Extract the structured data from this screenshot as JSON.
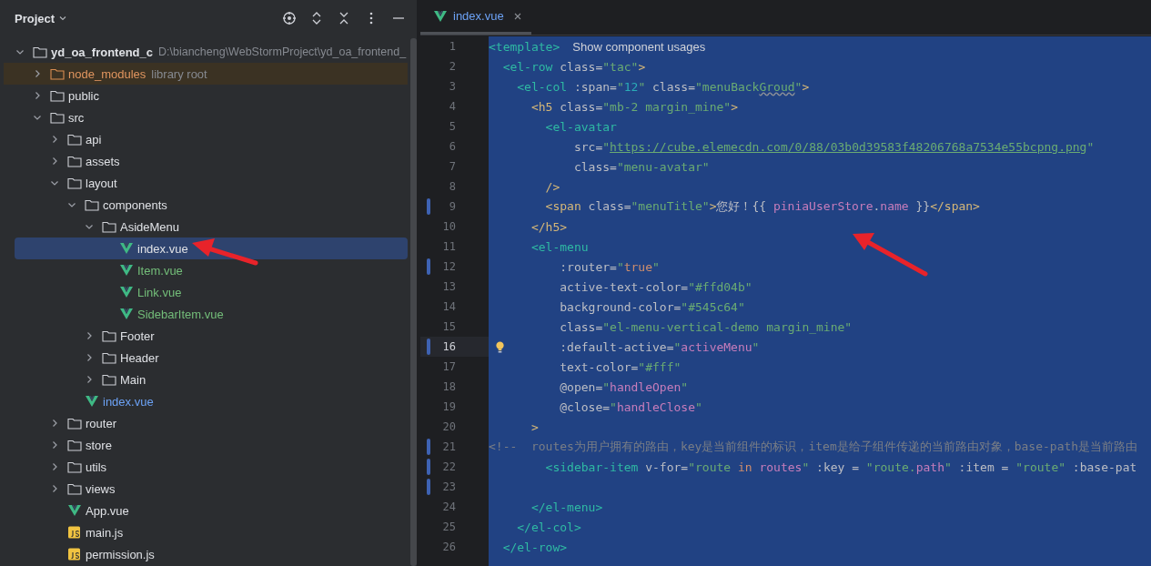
{
  "project_panel": {
    "title": "Project",
    "tree": [
      {
        "name": "yd_oa_frontend_c",
        "path": "D:\\biancheng\\WebStormProject\\yd_oa_frontend_",
        "kind": "folder",
        "expanded": true,
        "selected": false,
        "children": [
          {
            "name": "node_modules",
            "note": "library root",
            "kind": "library",
            "expanded": false,
            "selected": false
          },
          {
            "name": "public",
            "kind": "folder",
            "expanded": false,
            "selected": false
          },
          {
            "name": "src",
            "kind": "folder",
            "expanded": true,
            "selected": false,
            "children": [
              {
                "name": "api",
                "kind": "folder",
                "expanded": false,
                "selected": false
              },
              {
                "name": "assets",
                "kind": "folder",
                "expanded": false,
                "selected": false
              },
              {
                "name": "layout",
                "kind": "folder",
                "expanded": true,
                "selected": false,
                "children": [
                  {
                    "name": "components",
                    "kind": "folder",
                    "expanded": true,
                    "selected": false,
                    "children": [
                      {
                        "name": "AsideMenu",
                        "kind": "folder",
                        "expanded": true,
                        "selected": false,
                        "children": [
                          {
                            "name": "index.vue",
                            "kind": "vue",
                            "color": "#dfe1e5",
                            "selected": true
                          },
                          {
                            "name": "Item.vue",
                            "kind": "vue",
                            "color": "#73bd79",
                            "selected": false
                          },
                          {
                            "name": "Link.vue",
                            "kind": "vue",
                            "color": "#73bd79",
                            "selected": false
                          },
                          {
                            "name": "SidebarItem.vue",
                            "kind": "vue",
                            "color": "#73bd79",
                            "selected": false
                          }
                        ]
                      },
                      {
                        "name": "Footer",
                        "kind": "folder",
                        "expanded": false,
                        "selected": false
                      },
                      {
                        "name": "Header",
                        "kind": "folder",
                        "expanded": false,
                        "selected": false
                      },
                      {
                        "name": "Main",
                        "kind": "folder",
                        "expanded": false,
                        "selected": false
                      }
                    ]
                  },
                  {
                    "name": "index.vue",
                    "kind": "vue",
                    "color": "#6ca2f5",
                    "selected": false
                  }
                ]
              },
              {
                "name": "router",
                "kind": "folder",
                "expanded": false,
                "selected": false
              },
              {
                "name": "store",
                "kind": "folder",
                "expanded": false,
                "selected": false
              },
              {
                "name": "utils",
                "kind": "folder",
                "expanded": false,
                "selected": false
              },
              {
                "name": "views",
                "kind": "folder",
                "expanded": false,
                "selected": false
              },
              {
                "name": "App.vue",
                "kind": "vue",
                "color": "#dfe1e5",
                "selected": false
              },
              {
                "name": "main.js",
                "kind": "js",
                "color": "#dfe1e5",
                "selected": false
              },
              {
                "name": "permission.js",
                "kind": "js",
                "color": "#dfe1e5",
                "selected": false
              }
            ]
          }
        ]
      }
    ]
  },
  "editor": {
    "tabs": [
      {
        "label": "index.vue",
        "selected": true
      }
    ],
    "lines": [
      {
        "number": "1",
        "changed": false,
        "current": false,
        "tokens": [
          {
            "kind": "comp",
            "text": "<template>"
          }
        ],
        "hint": "Show component usages"
      },
      {
        "number": "2",
        "changed": false,
        "current": false,
        "tokens": [
          {
            "kind": "comp",
            "text": "  <el-row"
          },
          {
            "kind": "attr",
            "text": " class="
          },
          {
            "kind": "str",
            "text": "\"tac\""
          },
          {
            "kind": "br",
            "text": ">"
          }
        ]
      },
      {
        "number": "3",
        "changed": false,
        "current": false,
        "tokens": [
          {
            "kind": "comp",
            "text": "    <el-col"
          },
          {
            "kind": "attr",
            "text": " :span="
          },
          {
            "kind": "str",
            "text": "\""
          },
          {
            "kind": "num",
            "text": "12"
          },
          {
            "kind": "str",
            "text": "\""
          },
          {
            "kind": "attr",
            "text": " class="
          },
          {
            "kind": "str",
            "text": "\"menuBack"
          },
          {
            "kind": "typo",
            "text": "Groud"
          },
          {
            "kind": "str",
            "text": "\""
          },
          {
            "kind": "br",
            "text": ">"
          }
        ]
      },
      {
        "number": "4",
        "changed": false,
        "current": false,
        "tokens": [
          {
            "kind": "br",
            "text": "      <h5"
          },
          {
            "kind": "attr",
            "text": " class="
          },
          {
            "kind": "str",
            "text": "\"mb-2 margin_mine\""
          },
          {
            "kind": "br",
            "text": ">"
          }
        ]
      },
      {
        "number": "5",
        "changed": false,
        "current": false,
        "tokens": [
          {
            "kind": "comp",
            "text": "        <el-avatar"
          }
        ]
      },
      {
        "number": "6",
        "changed": false,
        "current": false,
        "tokens": [
          {
            "kind": "attr",
            "text": "            src="
          },
          {
            "kind": "str",
            "text": "\""
          },
          {
            "kind": "url",
            "text": "https://cube.elemecdn.com/0/88/03b0d39583f48206768a7534e55bcpng.png"
          },
          {
            "kind": "str",
            "text": "\""
          }
        ]
      },
      {
        "number": "7",
        "changed": false,
        "current": false,
        "tokens": [
          {
            "kind": "attr",
            "text": "            class="
          },
          {
            "kind": "str",
            "text": "\"menu-avatar\""
          }
        ]
      },
      {
        "number": "8",
        "changed": false,
        "current": false,
        "tokens": [
          {
            "kind": "br",
            "text": "        />"
          }
        ]
      },
      {
        "number": "9",
        "changed": true,
        "current": false,
        "tokens": [
          {
            "kind": "br",
            "text": "        <span"
          },
          {
            "kind": "attr",
            "text": " class="
          },
          {
            "kind": "str",
            "text": "\"menuTitle\""
          },
          {
            "kind": "br",
            "text": ">"
          },
          {
            "kind": "text",
            "text": "您好！{{ "
          },
          {
            "kind": "var",
            "text": "piniaUserStore"
          },
          {
            "kind": "text",
            "text": "."
          },
          {
            "kind": "var",
            "text": "name"
          },
          {
            "kind": "text",
            "text": " }}"
          },
          {
            "kind": "br",
            "text": "</span>"
          }
        ]
      },
      {
        "number": "10",
        "changed": false,
        "current": false,
        "tokens": [
          {
            "kind": "br",
            "text": "      </h5>"
          }
        ]
      },
      {
        "number": "11",
        "changed": false,
        "current": false,
        "tokens": [
          {
            "kind": "comp",
            "text": "      <el-menu"
          }
        ]
      },
      {
        "number": "12",
        "changed": true,
        "current": false,
        "tokens": [
          {
            "kind": "attr",
            "text": "          :router="
          },
          {
            "kind": "str",
            "text": "\""
          },
          {
            "kind": "kw",
            "text": "true"
          },
          {
            "kind": "str",
            "text": "\""
          }
        ]
      },
      {
        "number": "13",
        "changed": false,
        "current": false,
        "tokens": [
          {
            "kind": "attr",
            "text": "          active-text-color="
          },
          {
            "kind": "str",
            "text": "\"#ffd04b\""
          }
        ]
      },
      {
        "number": "14",
        "changed": false,
        "current": false,
        "tokens": [
          {
            "kind": "attr",
            "text": "          background-color="
          },
          {
            "kind": "str",
            "text": "\"#545c64\""
          }
        ]
      },
      {
        "number": "15",
        "changed": false,
        "current": false,
        "tokens": [
          {
            "kind": "attr",
            "text": "          class="
          },
          {
            "kind": "str",
            "text": "\"el-menu-vertical-demo margin_mine\""
          }
        ]
      },
      {
        "number": "16",
        "changed": true,
        "current": true,
        "tokens": [
          {
            "kind": "attr",
            "text": "          :default-active="
          },
          {
            "kind": "str",
            "text": "\""
          },
          {
            "kind": "var",
            "text": "activeMenu"
          },
          {
            "kind": "str",
            "text": "\""
          }
        ]
      },
      {
        "number": "17",
        "changed": false,
        "current": false,
        "tokens": [
          {
            "kind": "attr",
            "text": "          text-color="
          },
          {
            "kind": "str",
            "text": "\"#fff\""
          }
        ]
      },
      {
        "number": "18",
        "changed": false,
        "current": false,
        "tokens": [
          {
            "kind": "attr",
            "text": "          @open="
          },
          {
            "kind": "str",
            "text": "\""
          },
          {
            "kind": "var",
            "text": "handleOpen"
          },
          {
            "kind": "str",
            "text": "\""
          }
        ]
      },
      {
        "number": "19",
        "changed": false,
        "current": false,
        "tokens": [
          {
            "kind": "attr",
            "text": "          @close="
          },
          {
            "kind": "str",
            "text": "\""
          },
          {
            "kind": "var",
            "text": "handleClose"
          },
          {
            "kind": "str",
            "text": "\""
          }
        ]
      },
      {
        "number": "20",
        "changed": false,
        "current": false,
        "tokens": [
          {
            "kind": "br",
            "text": "      >"
          }
        ]
      },
      {
        "number": "21",
        "changed": true,
        "current": false,
        "tokens": [
          {
            "kind": "comment",
            "text": "<!--  routes为用户拥有的路由，key是当前组件的标识，item是给子组件传递的当前路由对象，base-path是当前路由"
          }
        ]
      },
      {
        "number": "22",
        "changed": true,
        "current": false,
        "tokens": [
          {
            "kind": "comp",
            "text": "        <sidebar-item"
          },
          {
            "kind": "attr",
            "text": " v-for="
          },
          {
            "kind": "str",
            "text": "\"route "
          },
          {
            "kind": "kw",
            "text": "in"
          },
          {
            "kind": "var",
            "text": " routes"
          },
          {
            "kind": "str",
            "text": "\""
          },
          {
            "kind": "attr",
            "text": " :key = "
          },
          {
            "kind": "str",
            "text": "\"route."
          },
          {
            "kind": "var",
            "text": "path"
          },
          {
            "kind": "str",
            "text": "\""
          },
          {
            "kind": "attr",
            "text": " :item = "
          },
          {
            "kind": "str",
            "text": "\"route\""
          },
          {
            "kind": "attr",
            "text": " :base-pat"
          }
        ]
      },
      {
        "number": "23",
        "changed": true,
        "current": false
      },
      {
        "number": "24",
        "changed": false,
        "current": false,
        "tokens": [
          {
            "kind": "comp",
            "text": "      </el-menu>"
          }
        ]
      },
      {
        "number": "25",
        "changed": false,
        "current": false,
        "tokens": [
          {
            "kind": "comp",
            "text": "    </el-col>"
          }
        ]
      },
      {
        "number": "26",
        "changed": false,
        "current": false,
        "tokens": [
          {
            "kind": "comp",
            "text": "  </el-row>"
          }
        ]
      }
    ]
  }
}
